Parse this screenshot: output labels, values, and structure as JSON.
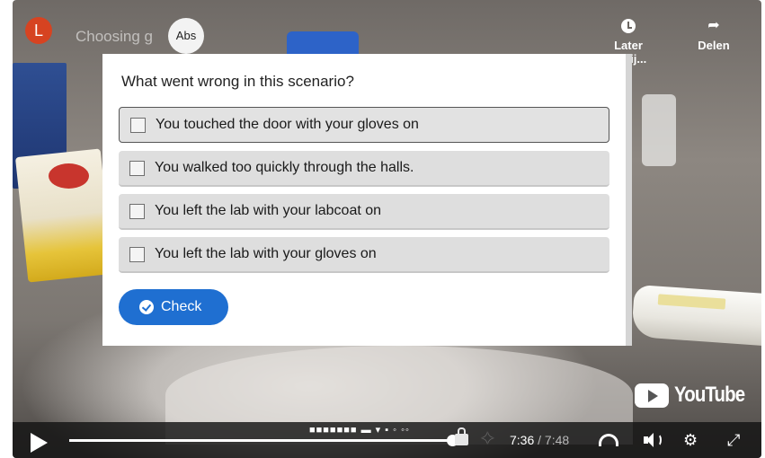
{
  "player": {
    "channel_initial": "L",
    "title_partial": "Choosing g",
    "chip_label": "Abs",
    "actions": [
      {
        "label": "Later bekij...",
        "icon": "clock-icon"
      },
      {
        "label": "Delen",
        "icon": "share-arrow-icon"
      }
    ],
    "brand": "YouTube"
  },
  "quiz": {
    "question": "What went wrong in this scenario?",
    "options": [
      {
        "label": "You touched the door with your gloves on",
        "checked": false,
        "focused": true
      },
      {
        "label": "You walked too quickly through the halls.",
        "checked": false,
        "focused": false
      },
      {
        "label": "You left the lab with your labcoat on",
        "checked": false,
        "focused": false
      },
      {
        "label": "You left the lab with your gloves on",
        "checked": false,
        "focused": false
      }
    ],
    "check_label": "Check"
  },
  "controls": {
    "current_time": "7:36",
    "separator": " / ",
    "duration": "7:48",
    "progress_fraction": 0.974,
    "chapter_text": "■■■■■■■ ▬ ▾ ▪ ◦ ◦◦",
    "icons": [
      "play-icon",
      "lock-icon",
      "star-icon",
      "gauge-icon",
      "volume-icon",
      "gear-icon",
      "fullscreen-icon"
    ]
  },
  "colors": {
    "check_button": "#1f6fd1",
    "option_bg": "#dedede",
    "channel_avatar": "#d64321"
  }
}
